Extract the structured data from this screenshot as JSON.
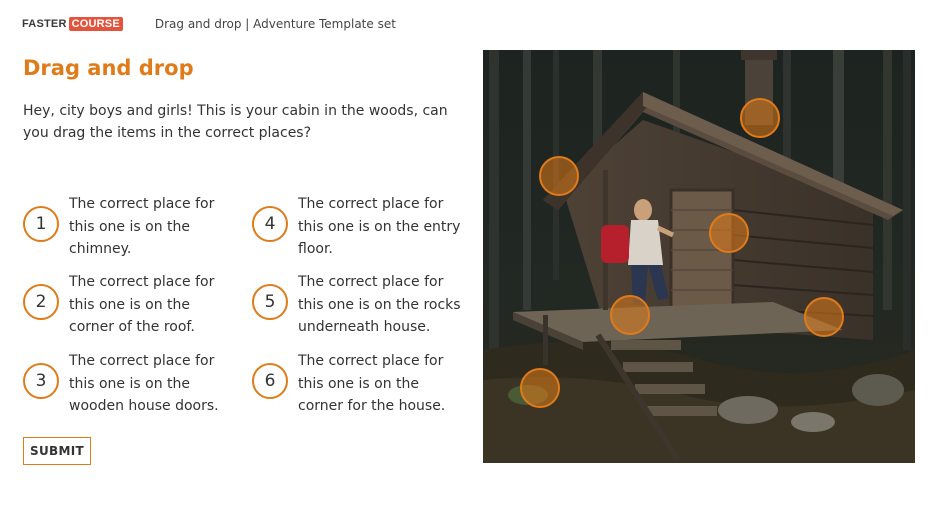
{
  "header": {
    "logo_part1": "FASTER",
    "logo_part2": "COURSE",
    "breadcrumb": "Drag and drop | Adventure Template set"
  },
  "title": "Drag and drop",
  "intro": "Hey, city boys and girls! This is your cabin in the woods, can you drag the items in the correct places?",
  "items": [
    {
      "number": "1",
      "text": "The correct place for this one is on the chimney."
    },
    {
      "number": "2",
      "text": "The correct place for this one is on the corner of the roof."
    },
    {
      "number": "3",
      "text": "The correct place for this one is on the wooden house doors."
    },
    {
      "number": "4",
      "text": "The correct place for this one is on the entry floor."
    },
    {
      "number": "5",
      "text": "The correct place for this one is on the rocks underneath house."
    },
    {
      "number": "6",
      "text": "The correct place for this one is on the corner for the house."
    }
  ],
  "submit_label": "SUBMIT",
  "colors": {
    "accent": "#e07b1a",
    "logo_red": "#e4533b"
  }
}
